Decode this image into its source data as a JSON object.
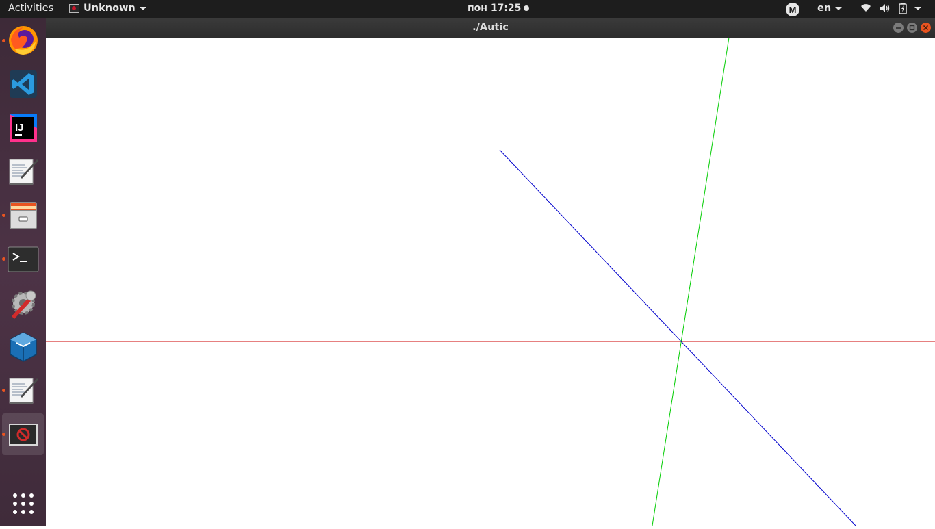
{
  "topbar": {
    "activities": "Activities",
    "app_menu": "Unknown",
    "clock": "пон 17:25",
    "keyboard_layout": "en",
    "account_letter": "M"
  },
  "dock": {
    "items": [
      {
        "name": "Firefox",
        "icon": "firefox-icon",
        "running": true
      },
      {
        "name": "Visual Studio Code",
        "icon": "vscode-icon",
        "running": false
      },
      {
        "name": "IntelliJ IDEA",
        "icon": "intellij-icon",
        "running": false
      },
      {
        "name": "Text Editor",
        "icon": "text-editor-icon",
        "running": false
      },
      {
        "name": "Files",
        "icon": "file-cabinet-icon",
        "running": true
      },
      {
        "name": "Terminal",
        "icon": "terminal-icon",
        "running": true
      },
      {
        "name": "System Tools",
        "icon": "wrench-gear-icon",
        "running": false
      },
      {
        "name": "VirtualBox",
        "icon": "virtualbox-icon",
        "running": false
      },
      {
        "name": "Text Editor",
        "icon": "text-editor-icon",
        "running": true
      },
      {
        "name": "Unknown application",
        "icon": "unknown-app-icon",
        "running": true,
        "active": true
      }
    ],
    "show_apps": "grid-icon"
  },
  "window": {
    "title": "./Autic"
  },
  "scene": {
    "lines": [
      {
        "name": "x-axis-line",
        "color": "#cc0000"
      },
      {
        "name": "y-axis-line",
        "color": "#00cc00"
      },
      {
        "name": "z-axis-line",
        "color": "#0000cc"
      }
    ]
  }
}
